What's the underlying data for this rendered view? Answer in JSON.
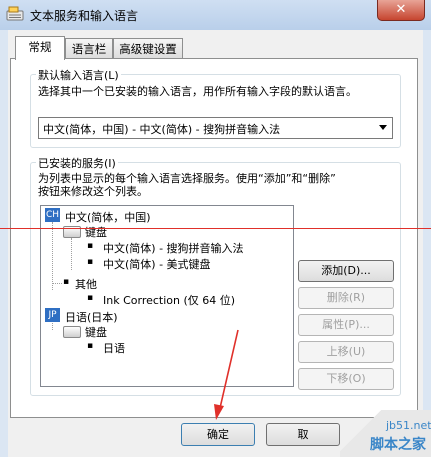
{
  "window": {
    "title": "文本服务和输入语言",
    "close_label": "✕"
  },
  "tabs": [
    {
      "label": "常规",
      "active": true
    },
    {
      "label": "语言栏",
      "active": false
    },
    {
      "label": "高级键设置",
      "active": false
    }
  ],
  "default_input": {
    "group_label": "默认输入语言(L)",
    "description": "选择其中一个已安装的输入语言，用作所有输入字段的默认语言。",
    "selected": "中文(简体，中国) - 中文(简体) - 搜狗拼音输入法"
  },
  "installed": {
    "group_label": "已安装的服务(I)",
    "description_line1": "为列表中显示的每个输入语言选择服务。使用“添加”和“删除”",
    "description_line2": "按钮来修改这个列表。",
    "tree": {
      "zh_badge": "CH",
      "zh_label": "中文(简体，中国)",
      "keyboard_label": "键盘",
      "zh_item1": "中文(简体) - 搜狗拼音输入法",
      "zh_item2": "中文(简体) - 美式键盘",
      "other_label": "其他",
      "other_item1": "Ink Correction (仅 64 位)",
      "ja_badge": "JP",
      "ja_label": "日语(日本)",
      "ja_keyboard_label": "键盘",
      "ja_item1": "日语"
    },
    "buttons": {
      "add": "添加(D)...",
      "remove": "删除(R)",
      "properties": "属性(P)...",
      "move_up": "上移(U)",
      "move_down": "下移(O)"
    }
  },
  "footer": {
    "ok": "确定",
    "cancel": "取"
  },
  "watermark": {
    "url": "jb51.net",
    "name": "脚本之家"
  },
  "colors": {
    "annotation_red": "#e0302a",
    "lang_badge": "#2f6fc3"
  }
}
